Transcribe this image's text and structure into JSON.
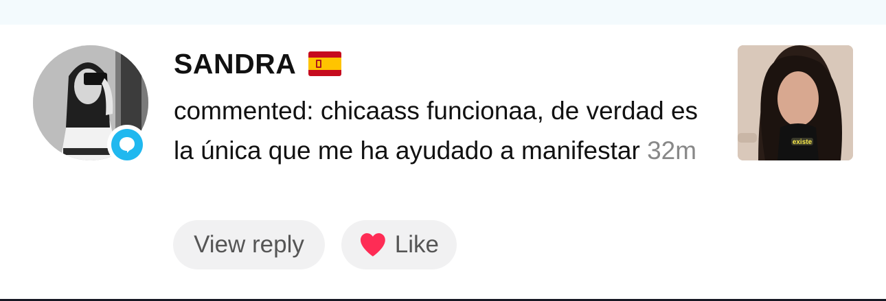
{
  "comment": {
    "username": "SANDRA",
    "flag": "spain-flag-emoji",
    "text": "commented: chicaass funcionaa, de verdad es la única que me ha ayudado a manifestar",
    "timestamp": "32m"
  },
  "actions": {
    "reply_label": "View reply",
    "like_label": "Like"
  },
  "thumbnail": {
    "caption": "existe"
  },
  "colors": {
    "badge": "#20b8ef",
    "heart": "#fe2c55",
    "pill_bg": "#f1f1f2",
    "top_band": "#f3fafd"
  }
}
